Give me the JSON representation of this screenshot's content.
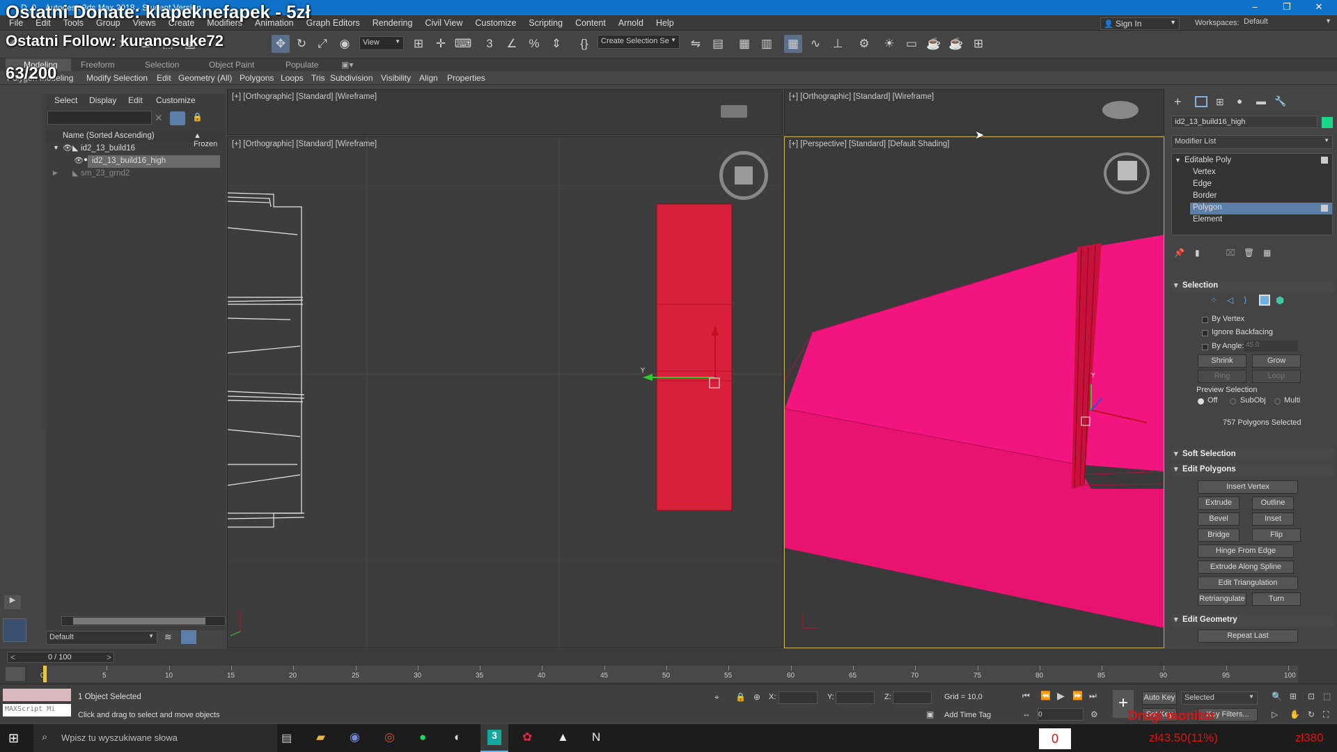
{
  "window": {
    "title": "D_0... Autodesk 3ds Max 2018 - Student Version",
    "sign_in": "Sign In",
    "workspaces_label": "Workspaces:",
    "workspace_value": "Default"
  },
  "menu": [
    "File",
    "Edit",
    "Tools",
    "Group",
    "Views",
    "Create",
    "Modifiers",
    "Animation",
    "Graph Editors",
    "Rendering",
    "Civil View",
    "Customize",
    "Scripting",
    "Content",
    "Arnold",
    "Help"
  ],
  "toolbar": {
    "view_dropdown": "View",
    "create_selection_set": "Create Selection Se"
  },
  "ribbon_tabs": [
    "Modeling",
    "Freeform",
    "Selection",
    "Object Paint",
    "Populate"
  ],
  "ribbon_tools": [
    "Polygon Modeling",
    "Modify Selection",
    "Edit",
    "Geometry (All)",
    "Polygons",
    "Loops",
    "Tris",
    "Subdivision",
    "Visibility",
    "Align",
    "Properties"
  ],
  "scene_explorer": {
    "tabs": [
      "Select",
      "Display",
      "Edit",
      "Customize"
    ],
    "col_name": "Name (Sorted Ascending)",
    "col_frozen": "▲ Frozen",
    "items": [
      "id2_13_build16",
      "id2_13_build16_high",
      "sm_23_grnd2"
    ],
    "layer": "Default"
  },
  "viewports": {
    "top_left": "[+] [Orthographic] [Standard] [Wireframe]",
    "top_right": "[+] [Orthographic] [Standard] [Wireframe]",
    "left": "[+] [Orthographic] [Standard] [Wireframe]",
    "persp": "[+] [Perspective] [Standard] [Default Shading]"
  },
  "command_panel": {
    "object_name": "id2_13_build16_high",
    "modifier_list": "Modifier List",
    "stack": [
      "Editable Poly",
      "Vertex",
      "Edge",
      "Border",
      "Polygon",
      "Element"
    ],
    "sections": {
      "selection": "Selection",
      "by_vertex": "By Vertex",
      "ignore_backfacing": "Ignore Backfacing",
      "by_angle": "By Angle:",
      "by_angle_value": "45.0",
      "shrink": "Shrink",
      "grow": "Grow",
      "ring": "Ring",
      "loop": "Loop",
      "preview_selection": "Preview Selection",
      "preview_off": "Off",
      "preview_subobj": "SubObj",
      "preview_multi": "Multi",
      "selected_count": "757 Polygons Selected",
      "soft_selection": "Soft Selection",
      "edit_polygons": "Edit Polygons",
      "insert_vertex": "Insert Vertex",
      "extrude": "Extrude",
      "outline": "Outline",
      "bevel": "Bevel",
      "inset": "Inset",
      "bridge": "Bridge",
      "flip": "Flip",
      "hinge": "Hinge From Edge",
      "extrude_spline": "Extrude Along Spline",
      "edit_triangulation": "Edit Triangulation",
      "retriangulate": "Retriangulate",
      "turn": "Turn",
      "edit_geometry": "Edit Geometry",
      "repeat_last": "Repeat Last"
    }
  },
  "timeline": {
    "frame": "0 / 100",
    "ticks": [
      "0",
      "5",
      "10",
      "15",
      "20",
      "25",
      "30",
      "35",
      "40",
      "45",
      "50",
      "55",
      "60",
      "65",
      "70",
      "75",
      "80",
      "85",
      "90",
      "95",
      "100"
    ]
  },
  "status": {
    "objects": "1 Object Selected",
    "prompt": "Click and drag to select and move objects",
    "maxscript": "MAXScript Mi",
    "x_label": "X:",
    "y_label": "Y:",
    "z_label": "Z:",
    "grid": "Grid = 10,0",
    "add_time_tag": "Add Time Tag",
    "auto_key": "Auto Key",
    "set_key": "Set Key",
    "selected": "Selected",
    "key_filters": "Key Filters...",
    "frame_value": "0"
  },
  "taskbar": {
    "search_placeholder": "Wpisz tu wyszukiwane słowa"
  },
  "overlays": {
    "donate": "Ostatni Donate: klapeknefapek - 5zł",
    "follow": "Ostatni Follow: kuranosuke72",
    "counter": "63/200",
    "drugi": "Drugi monitor",
    "zero": "0",
    "progress": "zł43.50(11%)",
    "goal": "zł380"
  },
  "colors": {
    "accent": "#0e72c8",
    "selection_red": "#d8203a",
    "persp_pink": "#f2147f"
  }
}
